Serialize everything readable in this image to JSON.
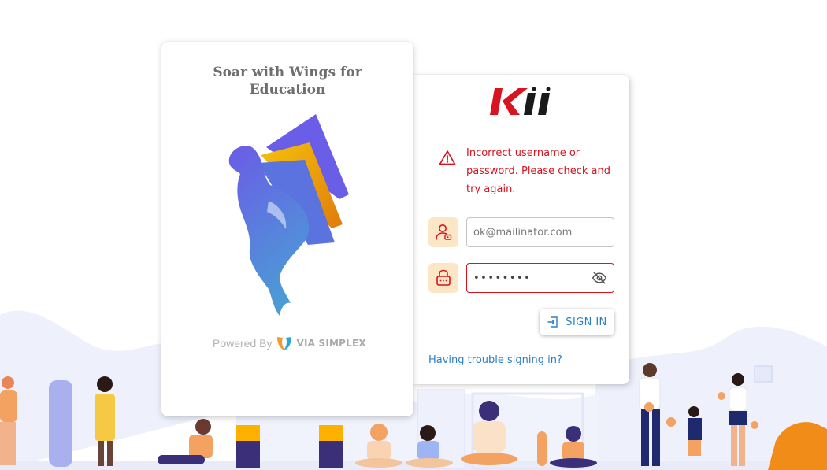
{
  "brand": {
    "title": "Soar with Wings for Education",
    "powered_by_label": "Powered By",
    "vendor_name": "VIA SIMPLEX"
  },
  "login": {
    "logo_text": "KII",
    "error_message": "Incorrect username or password. Please check and try again.",
    "email_placeholder": "ok@mailinator.com",
    "password_mask": "••••••••",
    "signin_label": "SIGN IN",
    "trouble_link": "Having trouble signing in?"
  },
  "icons": {
    "alert": "warning-triangle-icon",
    "user": "user-icon",
    "lock": "lock-icon",
    "eye": "eye-off-icon",
    "signin": "login-arrow-icon"
  },
  "colors": {
    "error": "#d7141f",
    "link": "#2c7fc5",
    "icon_bg": "#fbe6c6",
    "kii_red": "#d7141f",
    "kii_black": "#1a1a1a"
  }
}
